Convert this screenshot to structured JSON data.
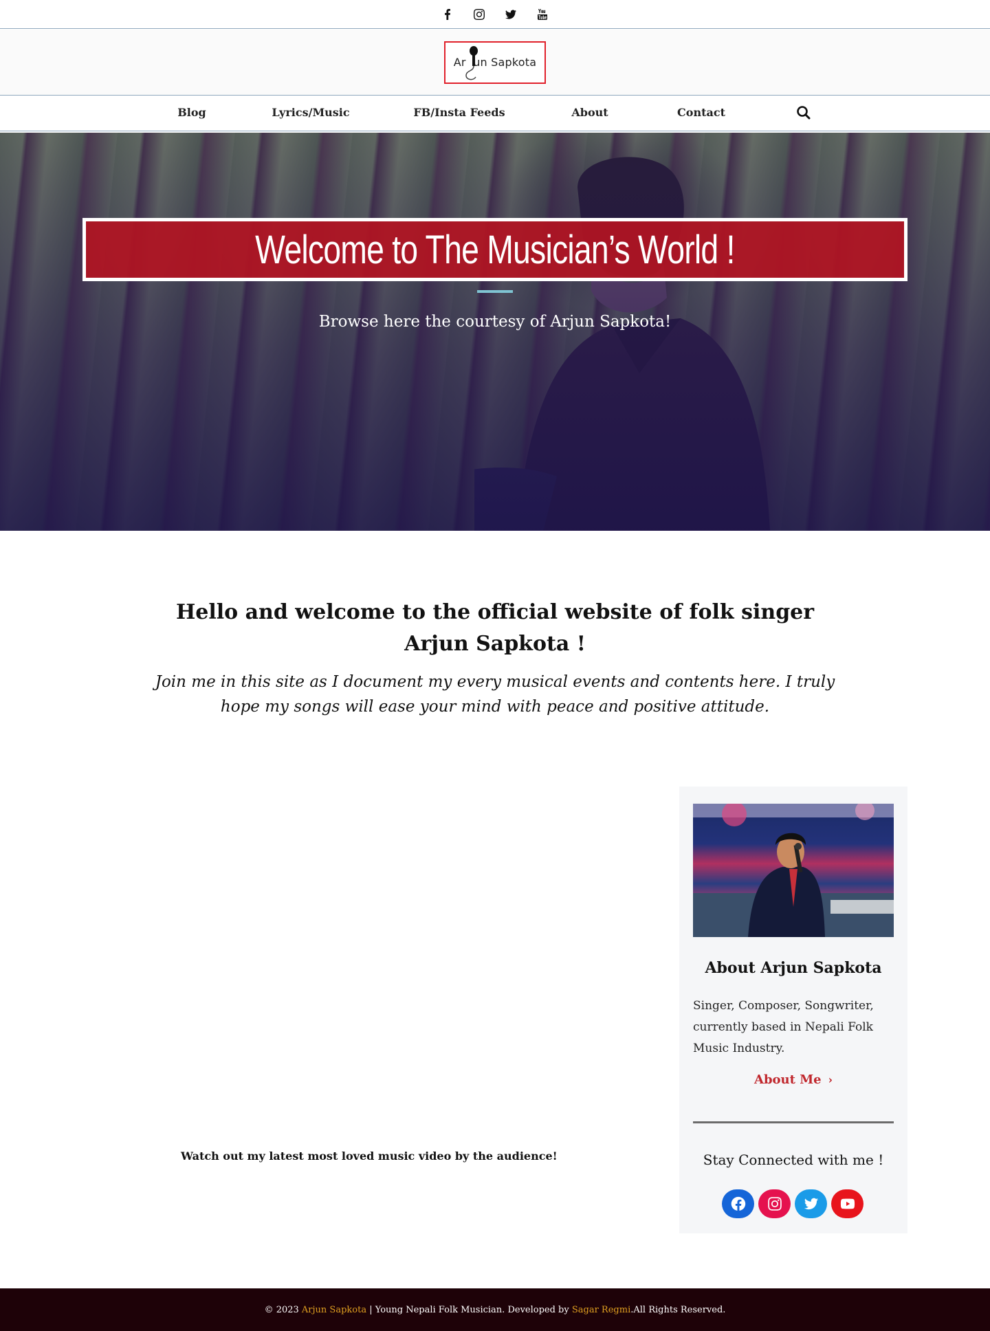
{
  "topbar": {
    "icons": [
      "facebook-icon",
      "instagram-icon",
      "twitter-icon",
      "youtube-icon"
    ]
  },
  "logo": {
    "text": "Ar  un Sapkota",
    "border_color": "#e0202a"
  },
  "nav": {
    "items": [
      {
        "label": "Blog"
      },
      {
        "label": "Lyrics/Music"
      },
      {
        "label": "FB/Insta Feeds"
      },
      {
        "label": "About"
      },
      {
        "label": "Contact"
      }
    ],
    "search_icon": "search-icon"
  },
  "hero": {
    "title": "Welcome to The Musician’s World !",
    "subtitle": "Browse here the courtesy of Arjun Sapkota!",
    "title_bg": "#b21422",
    "rule_color": "#7fc4d2"
  },
  "intro": {
    "heading_pre": "Hello and welcome to the official website of folk singer ",
    "heading_name": "Arjun Sapkota",
    "heading_post": " !",
    "paragraph": "Join me in this site as I document my every musical events and contents here. I truly hope my songs will ease your mind with peace and positive attitude."
  },
  "video": {
    "caption": "Watch out my latest most loved music video by the audience!"
  },
  "sidebar": {
    "about_title": "About Arjun Sapkota",
    "about_text": "Singer, Composer, Songwriter, currently based in Nepali Folk Music Industry.",
    "about_link": "About Me",
    "stay_connected": "Stay Connected with me !",
    "socials": [
      {
        "icon": "facebook-icon",
        "color": "#1565d8"
      },
      {
        "icon": "instagram-icon",
        "color": "#e5124e"
      },
      {
        "icon": "twitter-icon",
        "color": "#1a9be8"
      },
      {
        "icon": "youtube-icon",
        "color": "#e8141c"
      }
    ]
  },
  "footer": {
    "prefix": "© 2023 ",
    "name": "Arjun Sapkota",
    "middle": " | Young Nepali Folk Musician. Developed by ",
    "developer": "Sagar Regmi",
    "suffix": ".All Rights Reserved.",
    "bg": "#1e0208",
    "highlight": "#e0a020"
  }
}
